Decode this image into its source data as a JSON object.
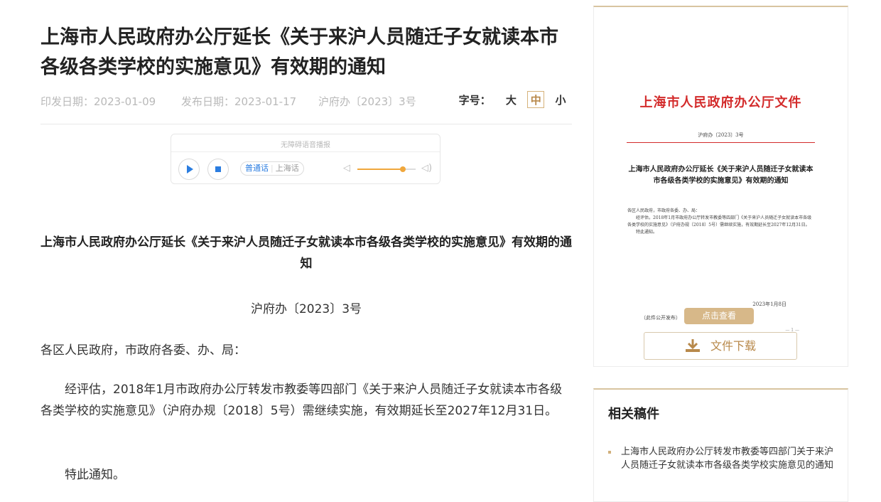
{
  "article": {
    "title": "上海市人民政府办公厅延长《关于来沪人员随迁子女就读本市各级各类学校的实施意见》有效期的通知",
    "meta": {
      "print_date": "印发日期：2023-01-09",
      "publish_date": "发布日期：2023-01-17",
      "doc_number": "沪府办〔2023〕3号"
    },
    "font_size": {
      "label": "字号：",
      "large": "大",
      "medium": "中",
      "small": "小",
      "selected": "中"
    },
    "player": {
      "title": "无障碍语音播报",
      "languages": [
        "普通话",
        "上海话"
      ],
      "selected_language": "普通话",
      "volume_fraction": 0.78
    },
    "doc_title": "上海市人民政府办公厅延长《关于来沪人员随迁子女就读本市各级各类学校的实施意见》有效期的通知",
    "doc_number": "沪府办〔2023〕3号",
    "paragraphs": [
      "各区人民政府，市政府各委、办、局：",
      "经评估，2018年1月市政府办公厅转发市教委等四部门《关于来沪人员随迁子女就读本市各级各类学校的实施意见》（沪府办规〔2018〕5号）需继续实施，有效期延长至2027年12月31日。",
      "特此通知。"
    ]
  },
  "sidebar": {
    "preview": {
      "header": "上海市人民政府办公厅文件",
      "number": "沪府办〔2023〕3号",
      "title": "上海市人民政府办公厅延长《关于来沪人员随迁子女就读本市各级各类学校的实施意见》有效期的通知",
      "salutation": "各区人民政府，市政府各委、办、局：",
      "body": "经评估，2018年1月市政府办公厅转发市教委等四部门《关于来沪人员随迁子女就读本市各级各类学校的实施意见》（沪府办规〔2018〕5号）需继续实施，有效期延长至2027年12月31日。",
      "closing": "特此通知。",
      "date": "2023年1月8日",
      "footnote": "（此件公开发布）",
      "page_no": "— 1 —"
    },
    "view_button": "点击查看",
    "download_button": "文件下载",
    "related": {
      "title": "相关稿件",
      "items": [
        "上海市人民政府办公厅转发市教委等四部门关于来沪人员随迁子女就读本市各级各类学校实施意见的通知"
      ]
    },
    "colors": {
      "accent_gold": "#d7b889",
      "red_header": "#d32b2b",
      "player_blue": "#2b7de0",
      "volume_orange": "#f0a73c"
    }
  }
}
